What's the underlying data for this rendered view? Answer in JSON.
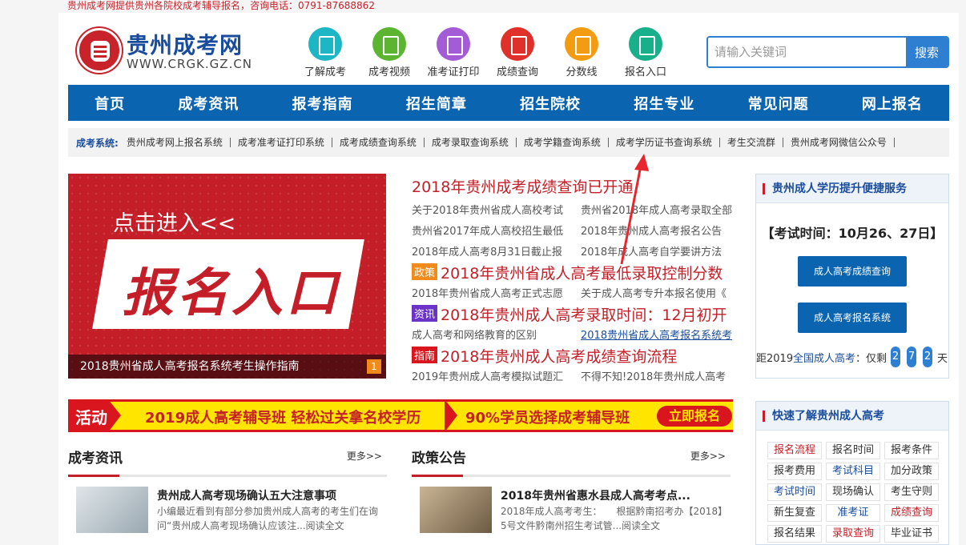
{
  "top_notice": "贵州成考网提供贵州各院校成考辅导报名，咨询电话：0791-87688862",
  "logo": {
    "name": "贵州成考网",
    "url": "WWW.CRGK.GZ.CN"
  },
  "quick_links": [
    {
      "label": "了解成考",
      "icon": "flask-icon",
      "color": "#1db6c4"
    },
    {
      "label": "成考视频",
      "icon": "building-icon",
      "color": "#5cb531"
    },
    {
      "label": "准考证打印",
      "icon": "ticket-icon",
      "color": "#a35bd6"
    },
    {
      "label": "成绩查询",
      "icon": "monitor-icon",
      "color": "#e0302a"
    },
    {
      "label": "分数线",
      "icon": "pen-icon",
      "color": "#f39c12"
    },
    {
      "label": "报名入口",
      "icon": "clipboard-icon",
      "color": "#18b08a"
    }
  ],
  "search": {
    "placeholder": "请输入关键词",
    "button": "搜索"
  },
  "nav": [
    "首页",
    "成考资讯",
    "报考指南",
    "招生简章",
    "招生院校",
    "招生专业",
    "常见问题",
    "网上报名"
  ],
  "systems": {
    "title": "成考系统:",
    "links": [
      "贵州成考网上报名系统",
      "成考准考证打印系统",
      "成考成绩查询系统",
      "成考录取查询系统",
      "成考学籍查询系统",
      "成考学历证书查询系统",
      "考生交流群",
      "贵州成考网微信公众号"
    ]
  },
  "banner": {
    "line1": "点击进入<<",
    "line2": "报名入口",
    "caption": "2018贵州省成人高考报名系统考生操作指南",
    "page": "1"
  },
  "news": {
    "headline": "2018年贵州成考成绩查询已开通",
    "rows1": [
      [
        "关于2018年贵州省成人高校考试",
        "贵州省2018年成人高考录取全部"
      ],
      [
        "贵州省2017年成人高校招生最低",
        "2018年贵州成人高考报名公告"
      ],
      [
        "2018年成人高考8月31日截止报",
        "2018年成人高考自学要讲方法"
      ]
    ],
    "feature1": {
      "tag": "政策",
      "tag_color": "#f08a1a",
      "title": "2018年贵州省成人高考最低录取控制分数"
    },
    "rows2": [
      [
        "2018年贵州省成人高考正式志愿",
        "关于成人高考专升本报名使用《"
      ]
    ],
    "feature2": {
      "tag": "资讯",
      "tag_color": "#6b33c8",
      "title": "2018年贵州成人高考录取时间：12月初开"
    },
    "rows3": [
      [
        "成人高考和网络教育的区别",
        "2018贵州省成人高考报名系统考"
      ]
    ],
    "feature3": {
      "tag": "指南",
      "tag_color": "#d9151e",
      "title": "2018年贵州成人高考成绩查询流程"
    },
    "rows4": [
      [
        "2019年贵州成人高考模拟试题汇",
        "不得不知!2018年贵州成人高考"
      ]
    ]
  },
  "side1": {
    "title": "贵州成人学历提升便捷服务",
    "exam_time": "【考试时间：10月26、27日】",
    "btn1": "成人高考成绩查询",
    "btn2": "成人高考报名系统",
    "cd_prefix": "距2019",
    "cd_link": "全国成人高考",
    "cd_mid": "：仅剩",
    "digits": [
      "2",
      "7",
      "2"
    ],
    "cd_suffix": "天"
  },
  "activity": {
    "tag": "活动",
    "msg1": "2019成人高考辅导班 轻松过关拿名校学历",
    "msg2": "90%学员选择成考辅导班",
    "cta": "立即报名"
  },
  "col1": {
    "title": "成考资讯",
    "more": "更多>>",
    "article_title": "贵州成人高考现场确认五大注意事项",
    "article_desc": "小编最近看到有部分参加贵州成人高考的考生们在询问“贵州成人高考现场确认应该注...阅读全文"
  },
  "col2": {
    "title": "政策公告",
    "more": "更多>>",
    "article_title": "2018年贵州省惠水县成人高考考点...",
    "article_desc": "2018年成人高考考生：　　根据黔南招考办【2018】5号文件黔南州招生考试管...阅读全文"
  },
  "side2": {
    "title": "快速了解贵州成人高考",
    "cells": [
      {
        "label": "报名流程",
        "style": "r"
      },
      {
        "label": "报名时间",
        "style": ""
      },
      {
        "label": "报考条件",
        "style": ""
      },
      {
        "label": "报考费用",
        "style": ""
      },
      {
        "label": "考试科目",
        "style": "b"
      },
      {
        "label": "加分政策",
        "style": ""
      },
      {
        "label": "考试时间",
        "style": "b"
      },
      {
        "label": "现场确认",
        "style": ""
      },
      {
        "label": "考生守则",
        "style": ""
      },
      {
        "label": "新生复查",
        "style": ""
      },
      {
        "label": "准考证",
        "style": "b"
      },
      {
        "label": "成绩查询",
        "style": "r"
      },
      {
        "label": "报名结果",
        "style": ""
      },
      {
        "label": "录取查询",
        "style": "r"
      },
      {
        "label": "毕业证书",
        "style": ""
      }
    ]
  }
}
